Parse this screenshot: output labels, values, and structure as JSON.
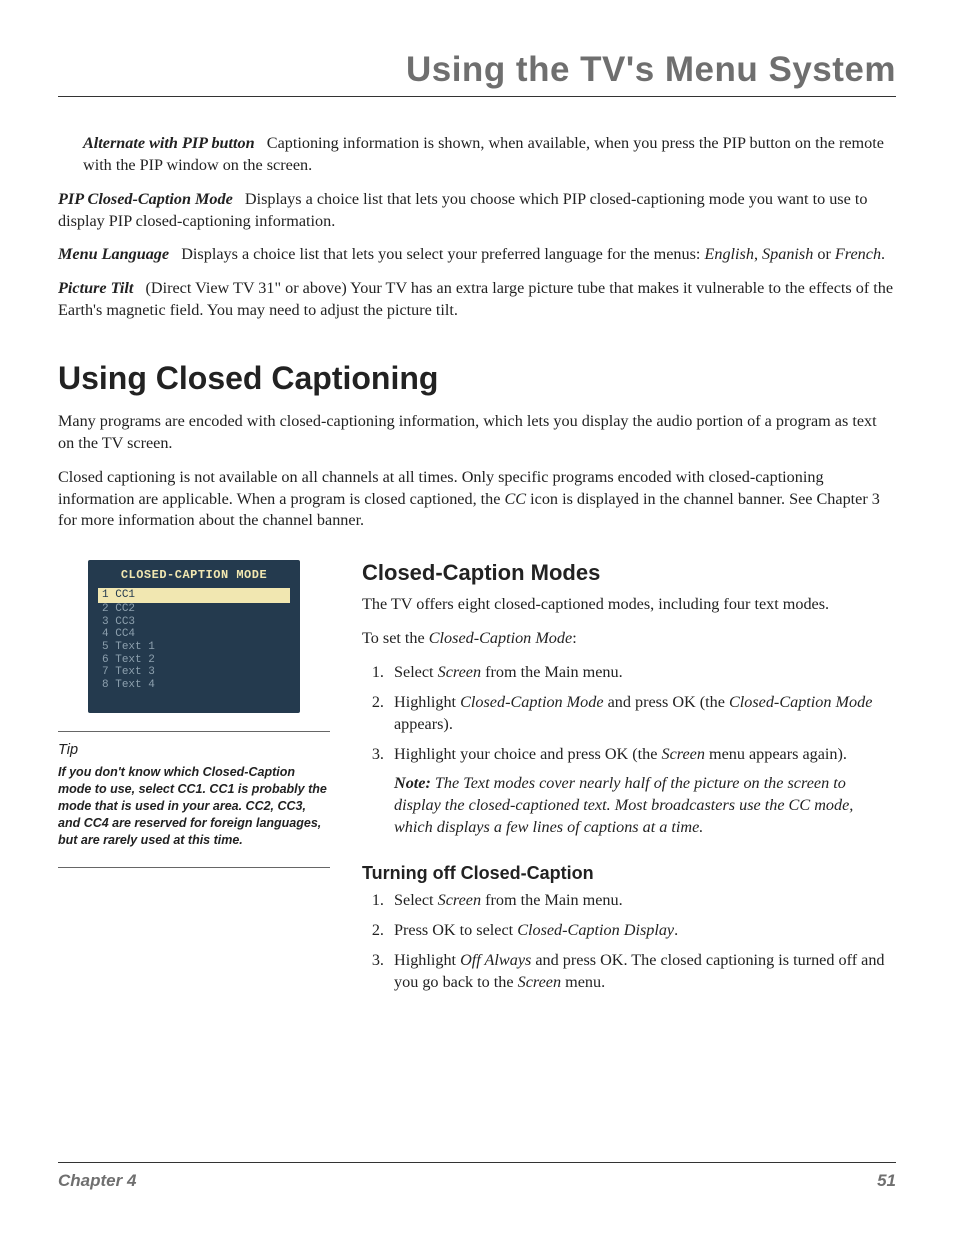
{
  "header": {
    "chapter_title": "Using the TV's Menu System"
  },
  "defs": {
    "alt_pip": {
      "term": "Alternate with PIP button",
      "text": "Captioning information is shown, when available, when you press the PIP button on the remote with the PIP window on the screen."
    },
    "pip_cc": {
      "term": "PIP Closed-Caption Mode",
      "text": "Displays a choice list that lets you choose which PIP closed-captioning mode you want to use to display PIP closed-captioning information."
    },
    "menu_lang": {
      "term": "Menu Language",
      "text_pre": "Displays a choice list that lets you select your preferred language for the menus: ",
      "lang1": "English",
      "sep1": ", ",
      "lang2": "Spanish",
      "sep2": " or ",
      "lang3": "French",
      "tail": "."
    },
    "pic_tilt": {
      "term": "Picture Tilt",
      "text": "(Direct View TV 31\" or above) Your TV has an extra large picture tube that makes it vulnerable to the effects of the Earth's magnetic field. You may need to adjust the picture tilt."
    }
  },
  "section": {
    "heading": "Using Closed Captioning",
    "p1": "Many programs are encoded with closed-captioning information, which lets you display the audio portion of a program as text on the TV screen.",
    "p2_a": "Closed captioning is not available on all channels at all times. Only specific programs encoded with closed-captioning information are applicable. When a program is closed captioned, the ",
    "p2_cc": "CC",
    "p2_b": " icon is displayed in the channel banner. See Chapter 3 for more information about the channel banner."
  },
  "cc_panel": {
    "title": "CLOSED-CAPTION MODE",
    "rows": [
      {
        "n": "1",
        "label": "CC1",
        "selected": true
      },
      {
        "n": "2",
        "label": "CC2",
        "selected": false
      },
      {
        "n": "3",
        "label": "CC3",
        "selected": false
      },
      {
        "n": "4",
        "label": "CC4",
        "selected": false
      },
      {
        "n": "5",
        "label": "Text 1",
        "selected": false
      },
      {
        "n": "6",
        "label": "Text 2",
        "selected": false
      },
      {
        "n": "7",
        "label": "Text 3",
        "selected": false
      },
      {
        "n": "8",
        "label": "Text 4",
        "selected": false
      }
    ]
  },
  "tip": {
    "label": "Tip",
    "text": "If you don't know which Closed-Caption mode to use, select CC1. CC1 is probably the mode that is used in your area. CC2, CC3, and CC4 are reserved for foreign languages, but are rarely used at this time."
  },
  "modes": {
    "heading": "Closed-Caption Modes",
    "intro": "The TV offers eight closed-captioned modes, including four text modes.",
    "set_pre": "To set the ",
    "set_em": "Closed-Caption Mode",
    "set_tail": ":",
    "step1_pre": "Select ",
    "step1_em": "Screen",
    "step1_post": " from the Main menu.",
    "step2_pre": "Highlight ",
    "step2_em1": "Closed-Caption Mode",
    "step2_mid": " and press OK  (the ",
    "step2_em2": "Closed-Caption Mode",
    "step2_post": " appears).",
    "step3_pre": "Highlight your choice and press OK (the ",
    "step3_em": "Screen",
    "step3_post": " menu appears again).",
    "note_label": "Note:",
    "note_text": " The Text modes cover nearly half of the picture on the screen to display the closed-captioned text. Most broadcasters use the CC mode, which displays a few lines of captions at a time."
  },
  "turnoff": {
    "heading": "Turning off Closed-Caption",
    "step1_pre": "Select ",
    "step1_em": "Screen",
    "step1_post": " from the Main menu.",
    "step2_pre": "Press OK to select ",
    "step2_em": "Closed-Caption Display",
    "step2_post": ".",
    "step3_pre": "Highlight ",
    "step3_em": "Off Always",
    "step3_mid": " and press OK. The closed captioning is turned off and you go back to the ",
    "step3_em2": "Screen",
    "step3_post": " menu."
  },
  "footer": {
    "chapter": "Chapter 4",
    "page": "51"
  }
}
